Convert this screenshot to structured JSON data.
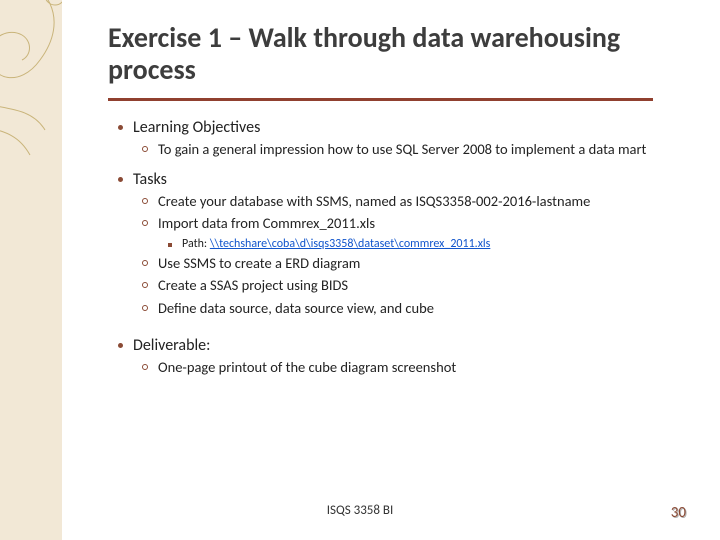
{
  "title": "Exercise 1 – Walk through data warehousing process",
  "sections": {
    "learning": {
      "heading": "Learning Objectives",
      "items": {
        "a": "To gain a general impression how to use SQL Server 2008 to implement a data mart"
      }
    },
    "tasks": {
      "heading": "Tasks",
      "items": {
        "a": "Create your database with SSMS, named as ISQS3358-002-2016-lastname",
        "b": "Import data from Commrex_2011.xls",
        "b_path_label": "Path: ",
        "b_path_link": "\\\\techshare\\coba\\d\\isqs3358\\dataset\\commrex_2011.xls",
        "c": "Use SSMS to create a ERD diagram",
        "d": "Create a SSAS project using BIDS",
        "e": "Define data source, data source view, and cube"
      }
    },
    "deliverable": {
      "heading": "Deliverable:",
      "items": {
        "a": "One-page printout of the cube diagram screenshot"
      }
    }
  },
  "footer": {
    "course": "ISQS 3358 BI",
    "page": "30"
  }
}
